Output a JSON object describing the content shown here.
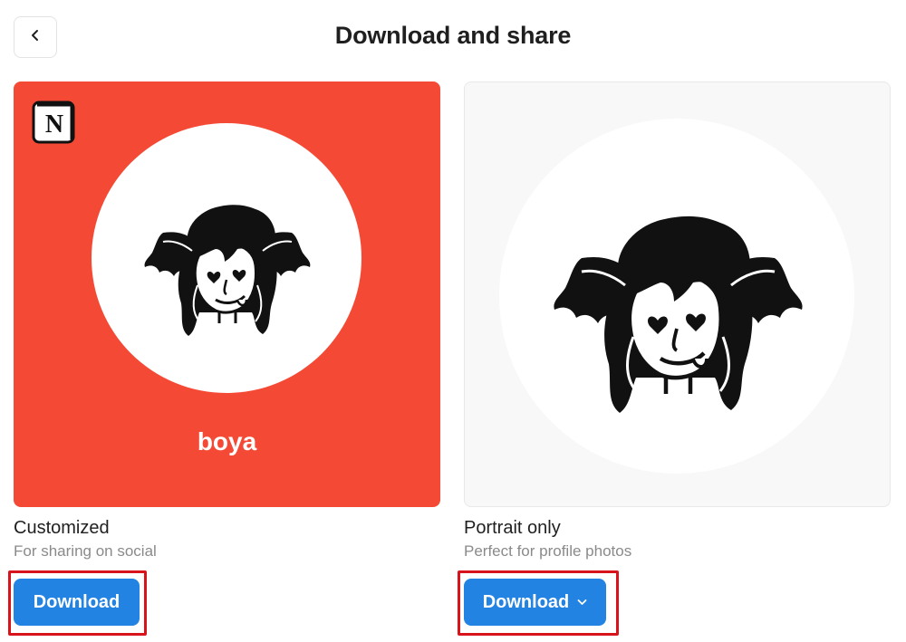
{
  "header": {
    "title": "Download and share",
    "back_icon": "chevron-left-icon"
  },
  "cards": {
    "customized": {
      "background_color": "#F44A35",
      "logo_icon": "notion-logo-icon",
      "name": "boya",
      "title": "Customized",
      "subtitle": "For sharing on social",
      "button_label": "Download"
    },
    "portrait": {
      "background_color": "#F8F8F8",
      "title": "Portrait only",
      "subtitle": "Perfect for profile photos",
      "button_label": "Download",
      "button_icon": "chevron-down-icon"
    }
  },
  "colors": {
    "accent": "#2383E2",
    "highlight": "#D9131C"
  }
}
